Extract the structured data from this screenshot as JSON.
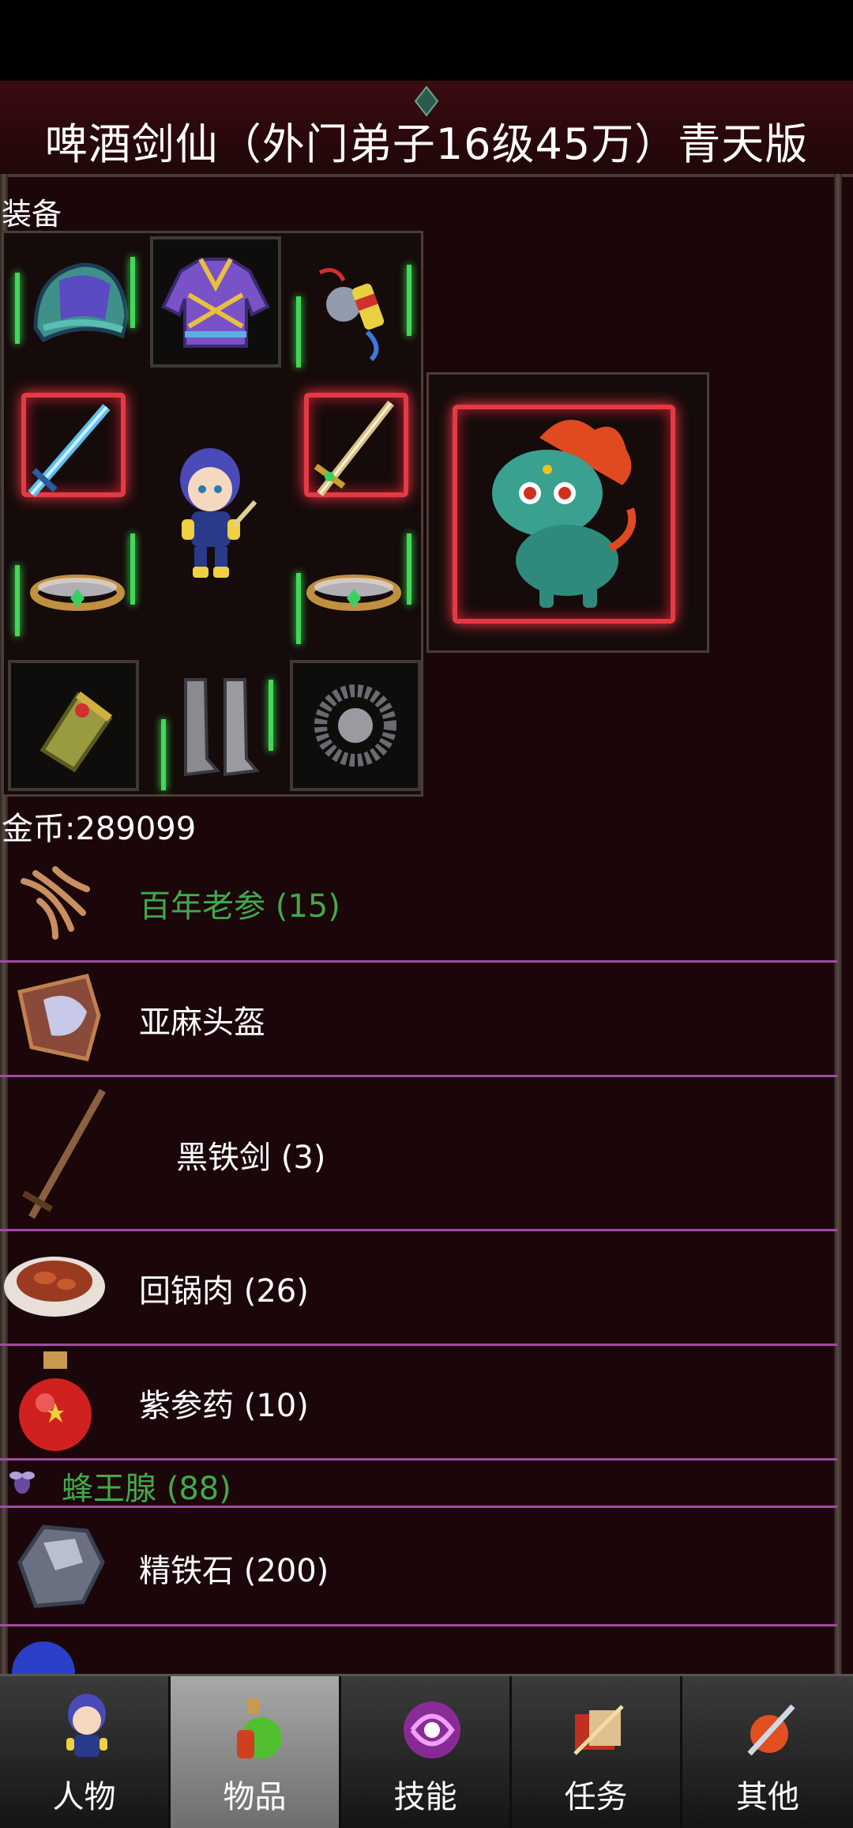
{
  "header": {
    "title": "啤酒剑仙（外门弟子16级45万）青天版"
  },
  "equipment": {
    "label": "装备"
  },
  "wallet": {
    "gold_text": "金币:289099"
  },
  "inventory": [
    {
      "name": "百年老参 (15)",
      "color": "#42a94a",
      "icon": "ginseng-icon"
    },
    {
      "name": "亚麻头盔",
      "color": "#ffffff",
      "icon": "helmet-icon"
    },
    {
      "name": "黑铁剑 (3)",
      "color": "#ffffff",
      "icon": "sword-icon"
    },
    {
      "name": "回锅肉 (26)",
      "color": "#ffffff",
      "icon": "meat-dish-icon"
    },
    {
      "name": "紫参药 (10)",
      "color": "#ffffff",
      "icon": "potion-icon"
    },
    {
      "name": "蜂王腺 (88)",
      "color": "#42a94a",
      "icon": "bee-icon"
    },
    {
      "name": "精铁石 (200)",
      "color": "#ffffff",
      "icon": "iron-ore-icon"
    }
  ],
  "nav": {
    "tabs": [
      {
        "label": "人物",
        "icon": "character-icon"
      },
      {
        "label": "物品",
        "icon": "items-icon",
        "active": true
      },
      {
        "label": "技能",
        "icon": "skills-icon"
      },
      {
        "label": "任务",
        "icon": "quests-icon"
      },
      {
        "label": "其他",
        "icon": "other-icon"
      }
    ]
  },
  "colors": {
    "background": "#1b0709",
    "divider": "#a04aa8",
    "rare_text": "#42a94a",
    "glow_green": "#45d65a",
    "glow_red": "#e23b45"
  }
}
